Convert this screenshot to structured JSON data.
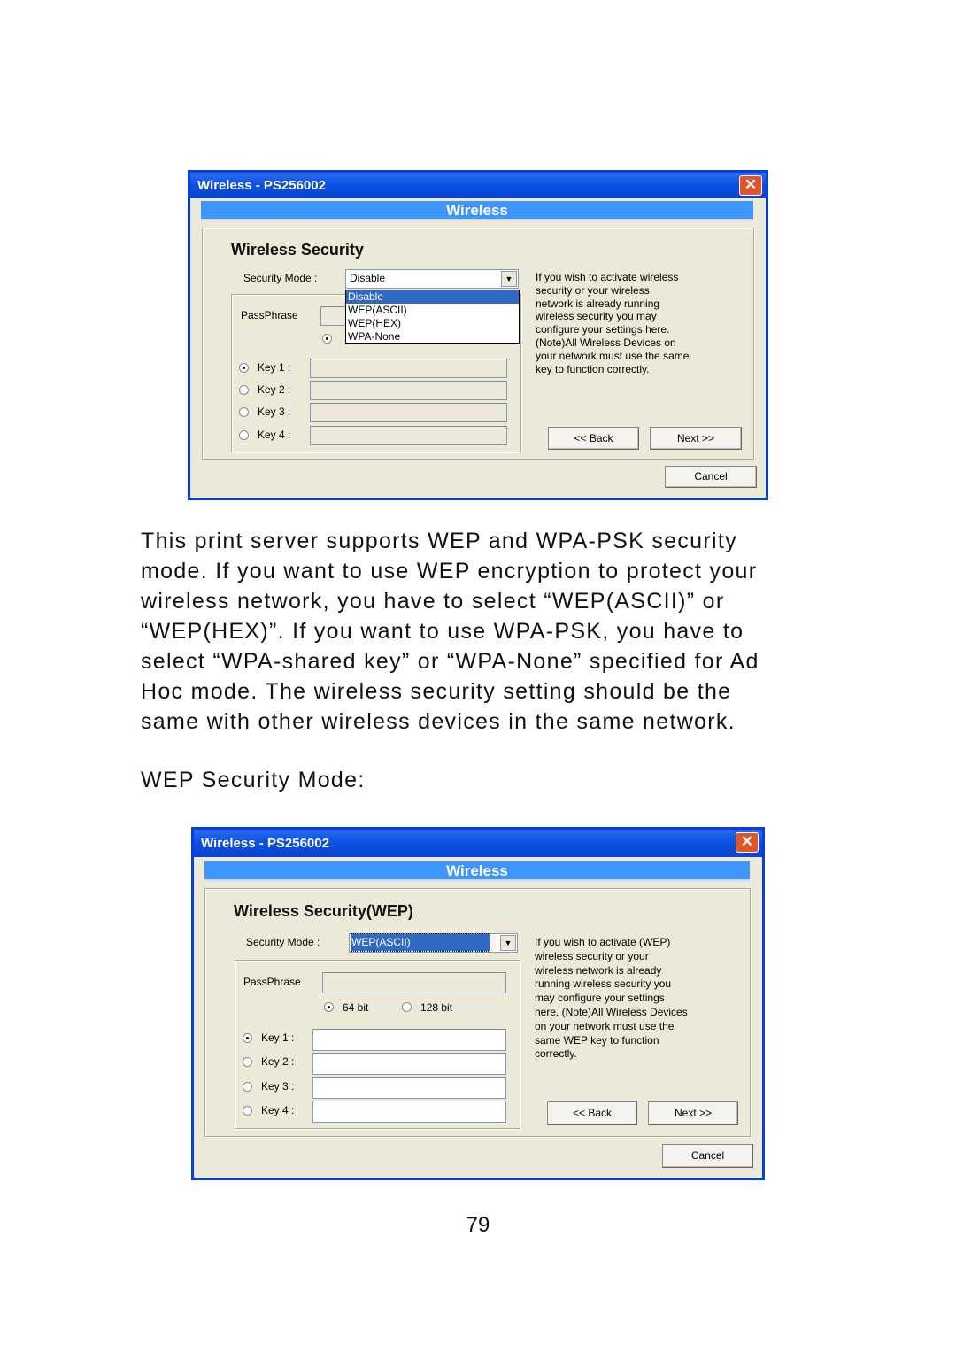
{
  "dialog1": {
    "title": "Wireless - PS256002",
    "banner": "Wireless",
    "heading": "Wireless Security",
    "security_mode_label": "Security Mode :",
    "security_mode_value": "Disable",
    "dropdown_options": [
      "Disable",
      "WEP(ASCII)",
      "WEP(HEX)",
      "WPA-None"
    ],
    "passphrase_label": "PassPhrase",
    "keys": [
      "Key 1 :",
      "Key 2 :",
      "Key 3 :",
      "Key 4 :"
    ],
    "description": [
      "If you wish to activate wireless",
      "security or your wireless",
      "network is already running",
      "wireless security you may",
      "configure your settings here.",
      "(Note)All Wireless Devices on",
      "your network must use the same",
      "key to function correctly."
    ],
    "back": "<< Back",
    "next": "Next >>",
    "cancel": "Cancel"
  },
  "body_text": [
    "This print server supports WEP and WPA-PSK security",
    "mode. If you want to use WEP encryption to protect your",
    "wireless network, you have to select “WEP(ASCII)” or",
    "“WEP(HEX)”. If you want to use WPA-PSK, you have to",
    "select “WPA-shared key” or “WPA-None” specified for Ad",
    "Hoc mode. The wireless security setting should be the",
    "same with other wireless devices in the same network."
  ],
  "section_label": "WEP Security Mode:",
  "dialog2": {
    "title": "Wireless - PS256002",
    "banner": "Wireless",
    "heading": "Wireless Security(WEP)",
    "security_mode_label": "Security Mode :",
    "security_mode_value": "WEP(ASCII)",
    "passphrase_label": "PassPhrase",
    "bit64": "64 bit",
    "bit128": "128 bit",
    "keys": [
      "Key 1 :",
      "Key 2 :",
      "Key 3 :",
      "Key 4 :"
    ],
    "description": [
      "If you wish to activate (WEP)",
      "wireless security or your",
      "wireless network is already",
      "running wireless security you",
      "may configure your settings",
      "here. (Note)All Wireless Devices",
      "on your network must use the",
      "same WEP key to function",
      "correctly."
    ],
    "back": "<< Back",
    "next": "Next >>",
    "cancel": "Cancel"
  },
  "page_number": "79",
  "colors": {
    "titlebar": "#0a4fe0",
    "banner": "#3d95ff",
    "dialog_bg": "#ece9d8",
    "selection": "#316ac5"
  }
}
